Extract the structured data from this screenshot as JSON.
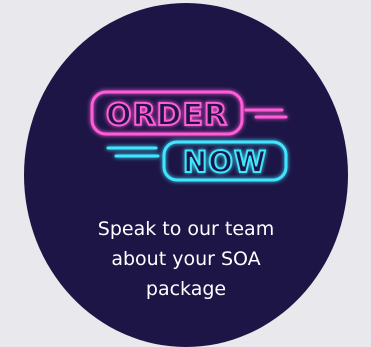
{
  "promo": {
    "neon_line1": "ORDER",
    "neon_line2": "NOW",
    "caption_lines": [
      "Speak to our team",
      "about your SOA",
      "package"
    ]
  },
  "colors": {
    "page_background": "#e9e9ed",
    "circle_background": "#1d1545",
    "neon_pink": "#ff5bd8",
    "neon_cyan": "#3fe6ff",
    "caption_text": "#ffffff"
  },
  "icons": {
    "badge": "order-now-neon-sign"
  }
}
